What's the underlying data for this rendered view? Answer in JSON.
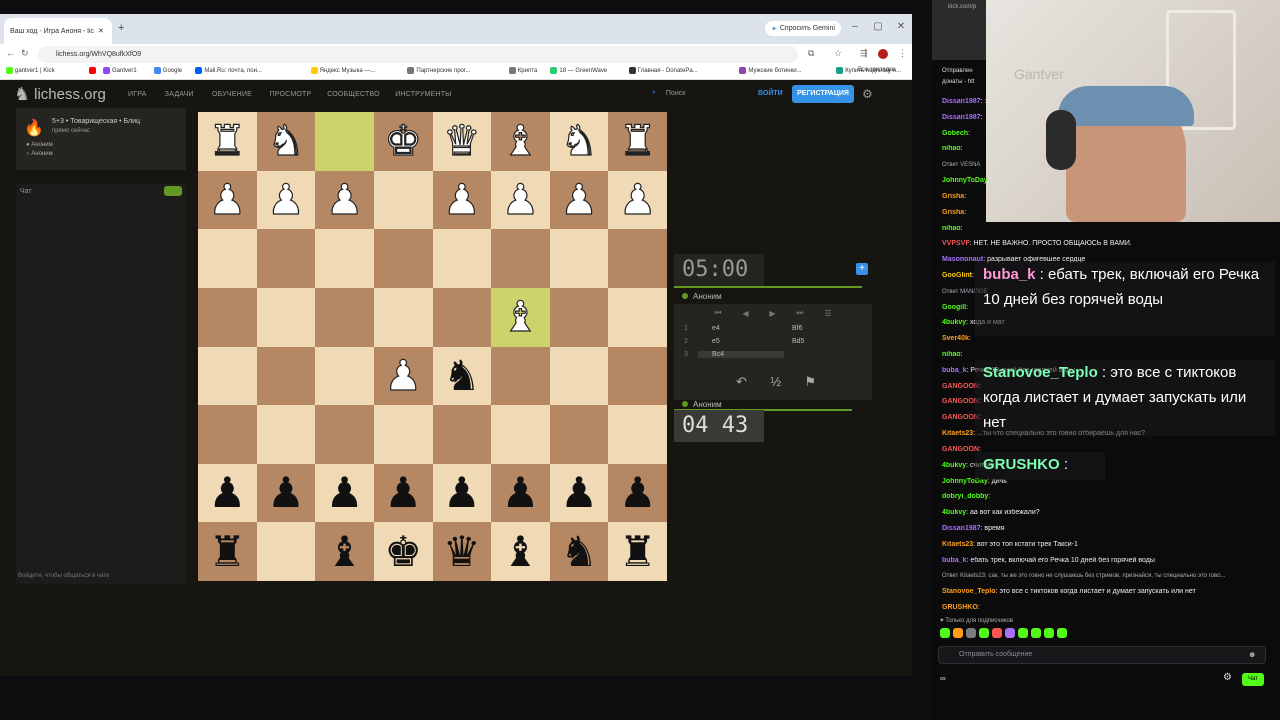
{
  "browser": {
    "tab_title": "Ваш ход - Игра Аноня - lichess",
    "gemini_button": "Спросить Gemini",
    "url": "lichess.org/WhVQ8ufkXfO9",
    "bookmarks": [
      {
        "label": "gantver1 | Kick",
        "color": "#53fc18"
      },
      {
        "label": "",
        "color": "#ff0000"
      },
      {
        "label": "Gantver1",
        "color": "#9146ff"
      },
      {
        "label": "Google",
        "color": "#4285f4"
      },
      {
        "label": "Mail.Ru: почта, пои...",
        "color": "#005ff9"
      },
      {
        "label": "Яндекс Музыка —...",
        "color": "#ffcc00"
      },
      {
        "label": "Партнерские прог...",
        "color": "#777777"
      },
      {
        "label": "Крипта",
        "color": "#777777"
      },
      {
        "label": "18 — GreenWave",
        "color": "#2ecc71"
      },
      {
        "label": "Главная - DonatePa...",
        "color": "#333333"
      },
      {
        "label": "Мужские ботинки...",
        "color": "#8e44ad"
      },
      {
        "label": "Купить подписку н...",
        "color": "#16a085"
      },
      {
        "label": "Статистика Telegra...",
        "color": "#2aabee"
      }
    ],
    "all_bookmarks": "Все закладки"
  },
  "lichess": {
    "logo": "lichess.org",
    "nav": [
      "ИГРА",
      "ЗАДАЧИ",
      "ОБУЧЕНИЕ",
      "ПРОСМОТР",
      "СООБЩЕСТВО",
      "ИНСТРУМЕНТЫ"
    ],
    "search": "Поиск",
    "login": "ВОЙТИ",
    "register": "РЕГИСТРАЦИЯ",
    "game": {
      "title": "5+3 • Товарищеская • Блиц",
      "subtitle": "прямо сейчас",
      "player1": "Аноним",
      "player2": "Аноним"
    },
    "chat_label": "Чат",
    "chat_placeholder": "Войдите, чтобы общаться в чате",
    "clock_top": "05:00",
    "clock_bottom": "04 43",
    "player_top": "Аноним",
    "player_bottom": "Аноним",
    "moves": [
      {
        "n": "1",
        "w": "e4",
        "b": "Bf6"
      },
      {
        "n": "2",
        "w": "e5",
        "b": "Bd5"
      },
      {
        "n": "3",
        "w": "Bc4",
        "b": ""
      }
    ],
    "half": "½",
    "board": [
      [
        "wR",
        "wN",
        "",
        "wK",
        "wQ",
        "wB",
        "wN",
        "wR"
      ],
      [
        "wP",
        "wP",
        "wP",
        "",
        "wP",
        "wP",
        "wP",
        "wP"
      ],
      [
        "",
        "",
        "",
        "",
        "",
        "",
        "",
        ""
      ],
      [
        "",
        "",
        "",
        "",
        "",
        "wB",
        "",
        ""
      ],
      [
        "",
        "",
        "",
        "wP",
        "bN",
        "",
        "",
        ""
      ],
      [
        "",
        "",
        "",
        "",
        "",
        "",
        "",
        ""
      ],
      [
        "bP",
        "bP",
        "bP",
        "bP",
        "bP",
        "bP",
        "bP",
        "bP"
      ],
      [
        "bR",
        "",
        "bB",
        "bK",
        "bQ",
        "bB",
        "bN",
        "bR"
      ]
    ],
    "highlights": [
      [
        0,
        2
      ],
      [
        3,
        5
      ]
    ]
  },
  "stream": {
    "side_url": "kick.com/p",
    "donation_banner": "Отправлен донаты - htt",
    "messages": [
      {
        "user": "Dissan1987",
        "text": ":",
        "color": "#a970ff"
      },
      {
        "user": "Dissan1987",
        "text": "",
        "color": "#a970ff"
      },
      {
        "user": "Gobech",
        "text": "",
        "color": "#53fc18"
      },
      {
        "user": "nihao",
        "text": "",
        "color": "#53fc18"
      },
      {
        "user": "",
        "text": "Ответ VESNA",
        "color": "#adadb8"
      },
      {
        "user": "JohnnyToDay",
        "text": "",
        "color": "#53fc18"
      },
      {
        "user": "Grisha",
        "text": "",
        "color": "#ff9f1a"
      },
      {
        "user": "Grisha",
        "text": "",
        "color": "#ff9f1a"
      },
      {
        "user": "nihao",
        "text": "",
        "color": "#53fc18"
      },
      {
        "user": "VVPSVF",
        "text": "НЕТ. НЕ ВАЖНО. ПРОСТО ОБЩАЮСЬ В ВАМИ.",
        "color": "#ff5555"
      },
      {
        "user": "Masononaut",
        "text": "разрывает офигевшее сердце",
        "color": "#a970ff"
      },
      {
        "user": "GooGlint",
        "text": "",
        "color": "#ffcc00"
      },
      {
        "user": "",
        "text": "Ответ MAN/ЛОЕ",
        "color": "#adadb8"
      },
      {
        "user": "Googill",
        "text": "",
        "color": "#53fc18"
      },
      {
        "user": "4bukvy",
        "text": "хода и мат",
        "color": "#53fc18"
      },
      {
        "user": "Sver40k",
        "text": "",
        "color": "#ff9f1a"
      },
      {
        "user": "nihao",
        "text": "",
        "color": "#53fc18"
      },
      {
        "user": "buba_k",
        "text": "Речка 10 дней без горячей воды",
        "color": "#a970ff"
      },
      {
        "user": "GANGOON",
        "text": "",
        "color": "#ff5555"
      },
      {
        "user": "GANGOON",
        "text": "",
        "color": "#ff5555"
      },
      {
        "user": "GANGOON",
        "text": "",
        "color": "#ff5555"
      },
      {
        "user": "Kitaets23",
        "text": "...ты что специально это говно отбираешь для нас?",
        "color": "#ff9f1a"
      },
      {
        "user": "GANGOON",
        "text": "",
        "color": "#ff5555"
      },
      {
        "user": "4bukvy",
        "text": "считай",
        "color": "#53fc18"
      },
      {
        "user": "JohnnyToDay",
        "text": "дичь",
        "color": "#53fc18"
      },
      {
        "user": "dobryi_dobby",
        "text": "",
        "color": "#53fc18"
      },
      {
        "user": "4bukvy",
        "text": "аа вот как избежали?",
        "color": "#53fc18"
      },
      {
        "user": "Dissan1987",
        "text": "время",
        "color": "#a970ff"
      },
      {
        "user": "Kitaets23",
        "text": "вот это топ кстати трек Такси-1",
        "color": "#ff9f1a"
      },
      {
        "user": "buba_k",
        "text": "ебать трек, включай его Речка 10 дней без горячей воды",
        "color": "#a970ff"
      },
      {
        "user": "",
        "text": "Ответ Kitaets23: сак, ты же это говно не слушаешь без стримов, признайся, ты специально это гово...",
        "color": "#adadb8"
      },
      {
        "user": "Stanovoe_Teplo",
        "text": "это все с тиктоков когда листает и думает запускать или нет",
        "color": "#ff9f1a"
      },
      {
        "user": "GRUSHKO",
        "text": "",
        "color": "#ff9f1a"
      }
    ],
    "overlay": [
      {
        "user": "buba_k",
        "text": ": ебать трек, включай его Речка 10 дней без горячей воды",
        "color": "#ff9ad5"
      },
      {
        "user": "Stanovoe_Teplo",
        "text": ": это все с тиктоков когда листает и думает запускать или нет",
        "color": "#7cffb2"
      },
      {
        "user": "GRUSHKO",
        "text": ":",
        "color": "#7cffb2"
      }
    ],
    "sub_only": "Только для подписчиков",
    "send_placeholder": "Отправить сообщение",
    "chat_button": "Чат"
  }
}
